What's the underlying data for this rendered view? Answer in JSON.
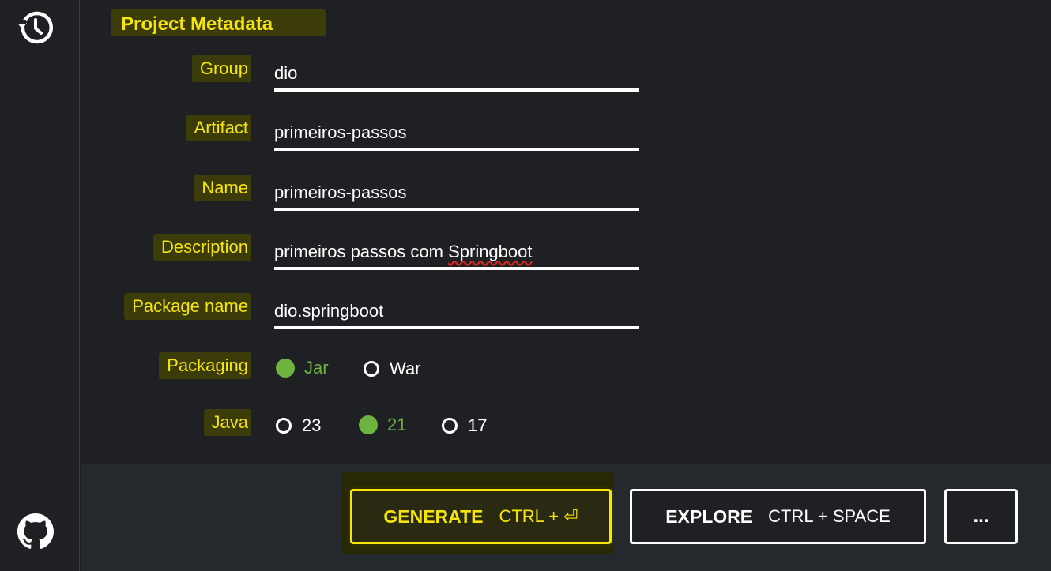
{
  "section_title": "Project Metadata",
  "fields": {
    "group": {
      "label": "Group",
      "value": "dio"
    },
    "artifact": {
      "label": "Artifact",
      "value": "primeiros-passos"
    },
    "name": {
      "label": "Name",
      "value": "primeiros-passos"
    },
    "description": {
      "label": "Description",
      "value_prefix": "primeiros passos com ",
      "value_misspelled": "Springboot"
    },
    "package_name": {
      "label": "Package name",
      "value": "dio.springboot"
    }
  },
  "packaging": {
    "label": "Packaging",
    "options": [
      {
        "label": "Jar",
        "selected": true
      },
      {
        "label": "War",
        "selected": false
      }
    ]
  },
  "java": {
    "label": "Java",
    "options": [
      {
        "label": "23",
        "selected": false
      },
      {
        "label": "21",
        "selected": true
      },
      {
        "label": "17",
        "selected": false
      }
    ]
  },
  "buttons": {
    "generate": {
      "label": "GENERATE",
      "shortcut": "CTRL + ⏎"
    },
    "explore": {
      "label": "EXPLORE",
      "shortcut": "CTRL + SPACE"
    },
    "more": {
      "label": "..."
    }
  },
  "icons": {
    "history": "history-icon",
    "github": "github-icon"
  },
  "colors": {
    "background": "#1e2024",
    "footer": "#25282c",
    "highlight_text": "#f5e50a",
    "selected_radio": "#6db33f",
    "spellcheck_underline": "#e0241b"
  }
}
